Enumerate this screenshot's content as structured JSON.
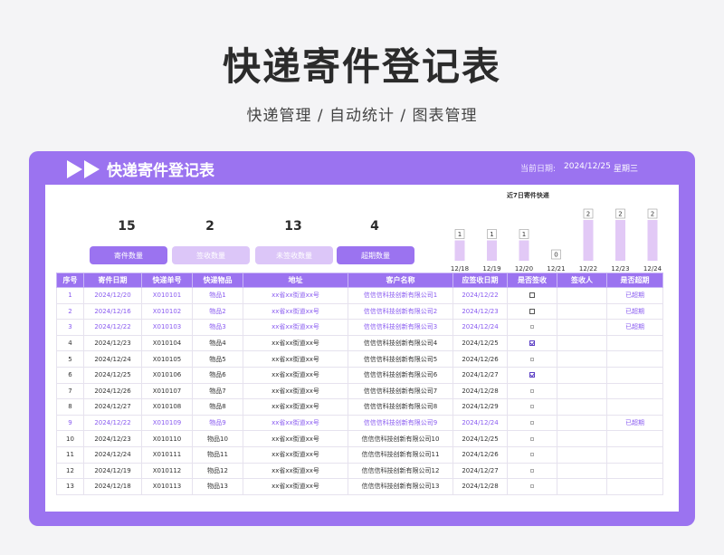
{
  "page": {
    "title": "快递寄件登记表",
    "subtitle": "快递管理 / 自动统计 / 图表管理"
  },
  "header": {
    "title": "快递寄件登记表",
    "date_label": "当前日期:",
    "date": "2024/12/25",
    "weekday": "星期三",
    "icon": "double-play-icon"
  },
  "stats": [
    {
      "value": "15",
      "label": "寄件数量"
    },
    {
      "value": "2",
      "label": "签收数量"
    },
    {
      "value": "13",
      "label": "未签收数量"
    },
    {
      "value": "4",
      "label": "超期数量"
    }
  ],
  "colors": {
    "accent": "#9b73f0",
    "accent_light": "#dcc6f8",
    "overdue_text": "#8a5cf0"
  },
  "chart_data": {
    "type": "bar",
    "title": "近7日寄件快递",
    "categories": [
      "12/18",
      "12/19",
      "12/20",
      "12/21",
      "12/22",
      "12/23",
      "12/24"
    ],
    "values": [
      1,
      1,
      1,
      0,
      2,
      2,
      2
    ],
    "ylim": [
      0,
      2
    ],
    "grid": false,
    "bar_color": "#e2c9f6"
  },
  "table": {
    "columns": [
      "序号",
      "寄件日期",
      "快递单号",
      "快递物品",
      "地址",
      "客户名称",
      "应签收日期",
      "是否签收",
      "签收人",
      "是否超期"
    ],
    "rows": [
      {
        "no": "1",
        "send_date": "2024/12/20",
        "tracking": "X010101",
        "item": "物品1",
        "address": "xx省xx街道xx号",
        "customer": "信信信科技创新有限公司1",
        "due": "2024/12/22",
        "signed": false,
        "big": true,
        "signer": "",
        "overdue": "已超期"
      },
      {
        "no": "2",
        "send_date": "2024/12/16",
        "tracking": "X010102",
        "item": "物品2",
        "address": "xx省xx街道xx号",
        "customer": "信信信科技创新有限公司2",
        "due": "2024/12/23",
        "signed": false,
        "big": true,
        "signer": "",
        "overdue": "已超期"
      },
      {
        "no": "3",
        "send_date": "2024/12/22",
        "tracking": "X010103",
        "item": "物品3",
        "address": "xx省xx街道xx号",
        "customer": "信信信科技创新有限公司3",
        "due": "2024/12/24",
        "signed": false,
        "big": false,
        "signer": "",
        "overdue": "已超期"
      },
      {
        "no": "4",
        "send_date": "2024/12/23",
        "tracking": "X010104",
        "item": "物品4",
        "address": "xx省xx街道xx号",
        "customer": "信信信科技创新有限公司4",
        "due": "2024/12/25",
        "signed": true,
        "big": true,
        "signer": "",
        "overdue": ""
      },
      {
        "no": "5",
        "send_date": "2024/12/24",
        "tracking": "X010105",
        "item": "物品5",
        "address": "xx省xx街道xx号",
        "customer": "信信信科技创新有限公司5",
        "due": "2024/12/26",
        "signed": false,
        "big": false,
        "signer": "",
        "overdue": ""
      },
      {
        "no": "6",
        "send_date": "2024/12/25",
        "tracking": "X010106",
        "item": "物品6",
        "address": "xx省xx街道xx号",
        "customer": "信信信科技创新有限公司6",
        "due": "2024/12/27",
        "signed": true,
        "big": true,
        "signer": "",
        "overdue": ""
      },
      {
        "no": "7",
        "send_date": "2024/12/26",
        "tracking": "X010107",
        "item": "物品7",
        "address": "xx省xx街道xx号",
        "customer": "信信信科技创新有限公司7",
        "due": "2024/12/28",
        "signed": false,
        "big": false,
        "signer": "",
        "overdue": ""
      },
      {
        "no": "8",
        "send_date": "2024/12/27",
        "tracking": "X010108",
        "item": "物品8",
        "address": "xx省xx街道xx号",
        "customer": "信信信科技创新有限公司8",
        "due": "2024/12/29",
        "signed": false,
        "big": false,
        "signer": "",
        "overdue": ""
      },
      {
        "no": "9",
        "send_date": "2024/12/22",
        "tracking": "X010109",
        "item": "物品9",
        "address": "xx省xx街道xx号",
        "customer": "信信信科技创新有限公司9",
        "due": "2024/12/24",
        "signed": false,
        "big": false,
        "signer": "",
        "overdue": "已超期"
      },
      {
        "no": "10",
        "send_date": "2024/12/23",
        "tracking": "X010110",
        "item": "物品10",
        "address": "xx省xx街道xx号",
        "customer": "信信信科技创新有限公司10",
        "due": "2024/12/25",
        "signed": false,
        "big": false,
        "signer": "",
        "overdue": ""
      },
      {
        "no": "11",
        "send_date": "2024/12/24",
        "tracking": "X010111",
        "item": "物品11",
        "address": "xx省xx街道xx号",
        "customer": "信信信科技创新有限公司11",
        "due": "2024/12/26",
        "signed": false,
        "big": false,
        "signer": "",
        "overdue": ""
      },
      {
        "no": "12",
        "send_date": "2024/12/19",
        "tracking": "X010112",
        "item": "物品12",
        "address": "xx省xx街道xx号",
        "customer": "信信信科技创新有限公司12",
        "due": "2024/12/27",
        "signed": false,
        "big": false,
        "signer": "",
        "overdue": ""
      },
      {
        "no": "13",
        "send_date": "2024/12/18",
        "tracking": "X010113",
        "item": "物品13",
        "address": "xx省xx街道xx号",
        "customer": "信信信科技创新有限公司13",
        "due": "2024/12/28",
        "signed": false,
        "big": false,
        "signer": "",
        "overdue": ""
      }
    ]
  }
}
